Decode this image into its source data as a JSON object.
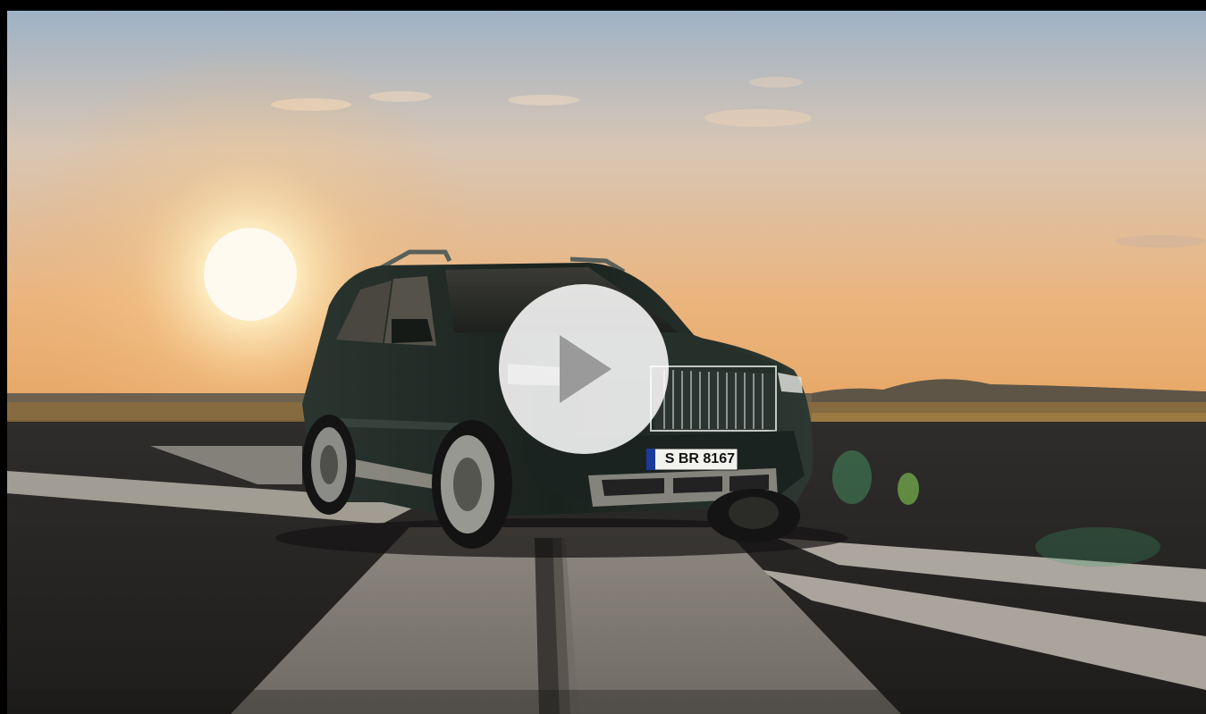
{
  "video": {
    "plate_text": "S BR 8167",
    "play_control": "play-icon"
  },
  "colors": {
    "sky_top": "#9fb3c7",
    "sky_horizon": "#e8b57a",
    "sun": "#fff6d8",
    "ground": "#6e6250",
    "asphalt": "#2a2826",
    "runway_light": "#b9b4ac",
    "car_body": "#1d2521",
    "play_overlay": "#ffffff",
    "play_glyph": "#9a9a9a"
  }
}
